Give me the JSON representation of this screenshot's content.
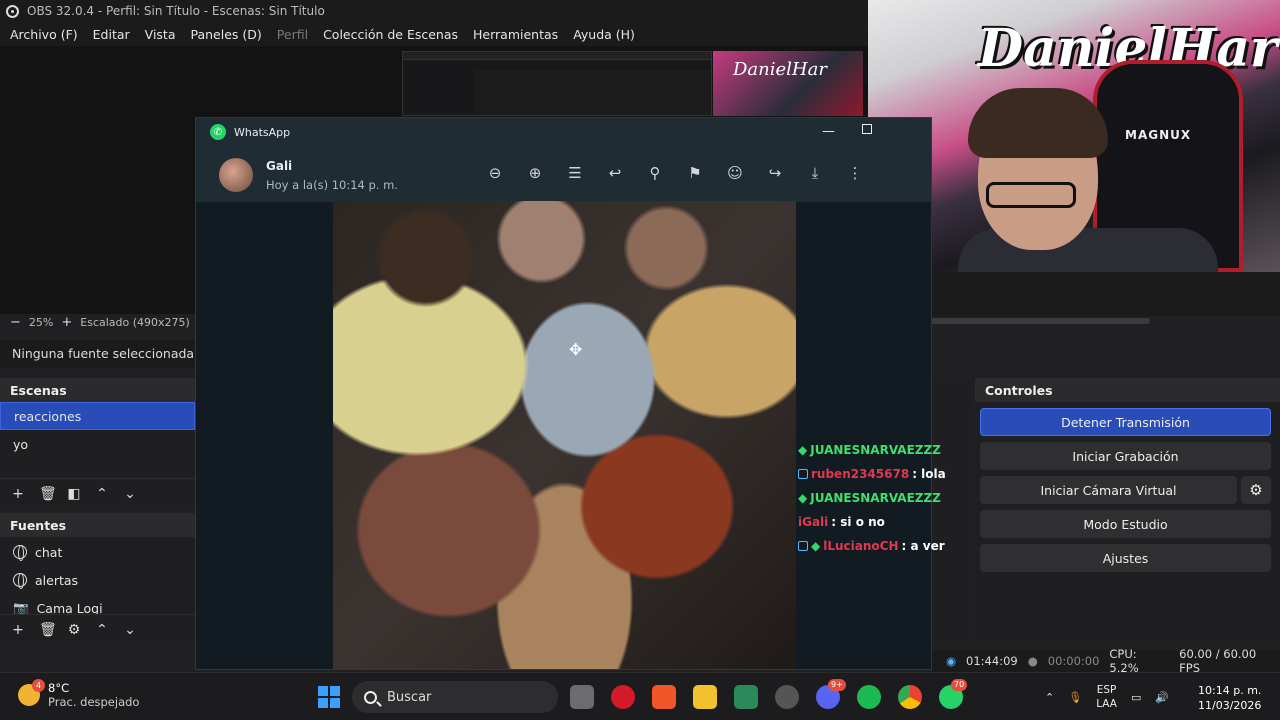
{
  "obs": {
    "title": "OBS 32.0.4 - Perfil: Sin Título - Escenas: Sin Título",
    "menu": [
      "Archivo (F)",
      "Editar",
      "Vista",
      "Paneles (D)",
      "Perfil",
      "Colección de Escenas",
      "Herramientas",
      "Ayuda (H)"
    ],
    "zoom": {
      "minus": "−",
      "value": "25%",
      "plus": "+",
      "scale_label": "Escalado (490x275)"
    },
    "no_source": "Ninguna fuente seleccionada",
    "scenes": {
      "title": "Escenas",
      "items": [
        "reacciones",
        "yo"
      ]
    },
    "sources": {
      "title": "Fuentes",
      "items": [
        "chat",
        "alertas",
        "Cama Logi"
      ]
    },
    "controls": {
      "title": "Controles",
      "buttons": [
        "Detener Transmisión",
        "Iniciar Grabación",
        "Iniciar Cámara Virtual",
        "Modo Estudio",
        "Ajustes"
      ]
    },
    "status": {
      "live_time": "01:44:09",
      "rec_time": "00:00:00",
      "cpu": "CPU: 5.2%",
      "fps": "60.00 / 60.00 FPS"
    }
  },
  "webcam": {
    "graffiti": "DanielHar",
    "chair_brand": "MAGNUX"
  },
  "whatsapp": {
    "app_name": "WhatsApp",
    "contact": "Gali",
    "timestamp": "Hoy a la(s) 10:14 p. m.",
    "toolbar_icons": [
      "zoom-out-icon",
      "zoom-in-icon",
      "caption-icon",
      "reply-icon",
      "pin-icon",
      "bookmark-icon",
      "emoji-icon",
      "forward-icon",
      "download-icon",
      "more-icon"
    ]
  },
  "chat": [
    {
      "user": "JUANESNARVAEZZZ",
      "message": "",
      "color": "#3fe06a"
    },
    {
      "user": "ruben2345678",
      "message": ": lola",
      "color": "#e0394f"
    },
    {
      "user": "JUANESNARVAEZZZ",
      "message": "",
      "color": "#3fe06a"
    },
    {
      "user": "iGali",
      "message": ": si o no",
      "color": "#e0394f"
    },
    {
      "user": "lLucianoCH",
      "message": ": a ver",
      "color": "#e0394f"
    }
  ],
  "taskbar": {
    "weather_temp": "8°C",
    "weather_desc": "Prac. despejado",
    "weather_badge": "4",
    "search_placeholder": "Buscar",
    "whatsapp_badge": "70",
    "discord_badge": "9+",
    "lang_1": "ESP",
    "lang_2": "LAA",
    "time": "10:14 p. m.",
    "date": "11/03/2026"
  }
}
